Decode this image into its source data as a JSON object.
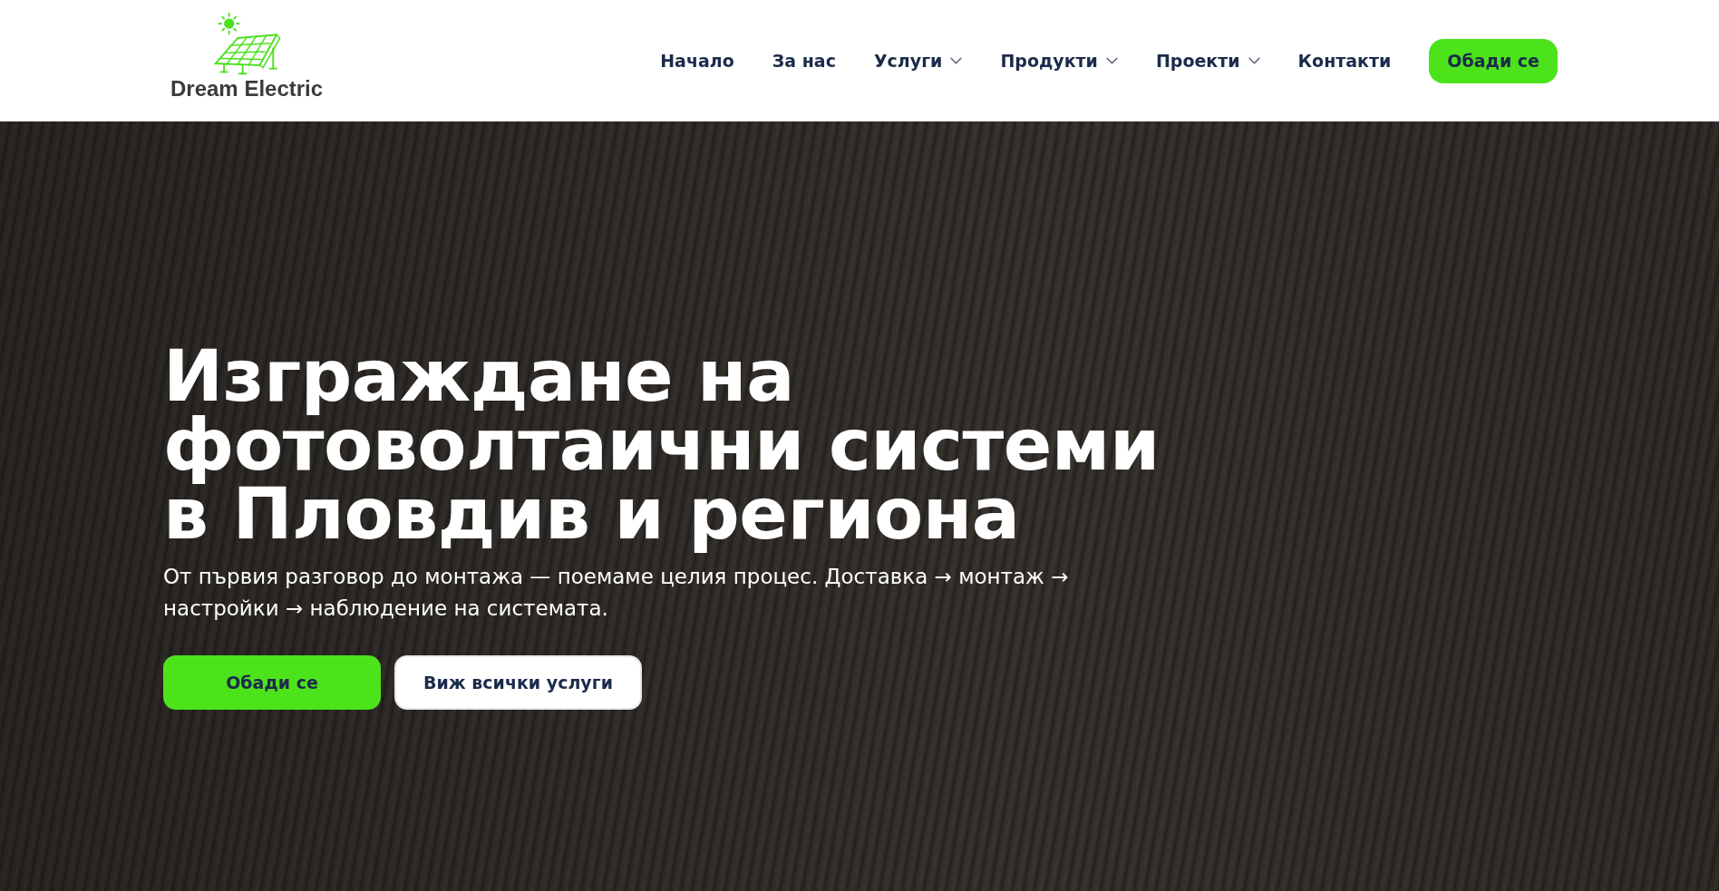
{
  "header": {
    "logo": {
      "brand_name": "Dream Electric"
    },
    "nav": [
      {
        "label": "Начало",
        "kind": "link"
      },
      {
        "label": "За нас",
        "kind": "link"
      },
      {
        "label": "Услуги",
        "kind": "dropdown"
      },
      {
        "label": "Продукти",
        "kind": "dropdown"
      },
      {
        "label": "Проекти",
        "kind": "dropdown"
      },
      {
        "label": "Контакти",
        "kind": "link"
      }
    ],
    "cta_button": "Обади се"
  },
  "hero": {
    "title": "Изграждане на фотоволтаични системи в Пловдив и региона",
    "subtitle": "От първия разговор до монтажа — поемаме целия процес. Доставка → монтаж → настройки → наблюдение на системата.",
    "buttons": [
      {
        "label": "Обади се",
        "kind": "primary"
      },
      {
        "label": "Виж всички услуги",
        "kind": "secondary"
      }
    ]
  }
}
